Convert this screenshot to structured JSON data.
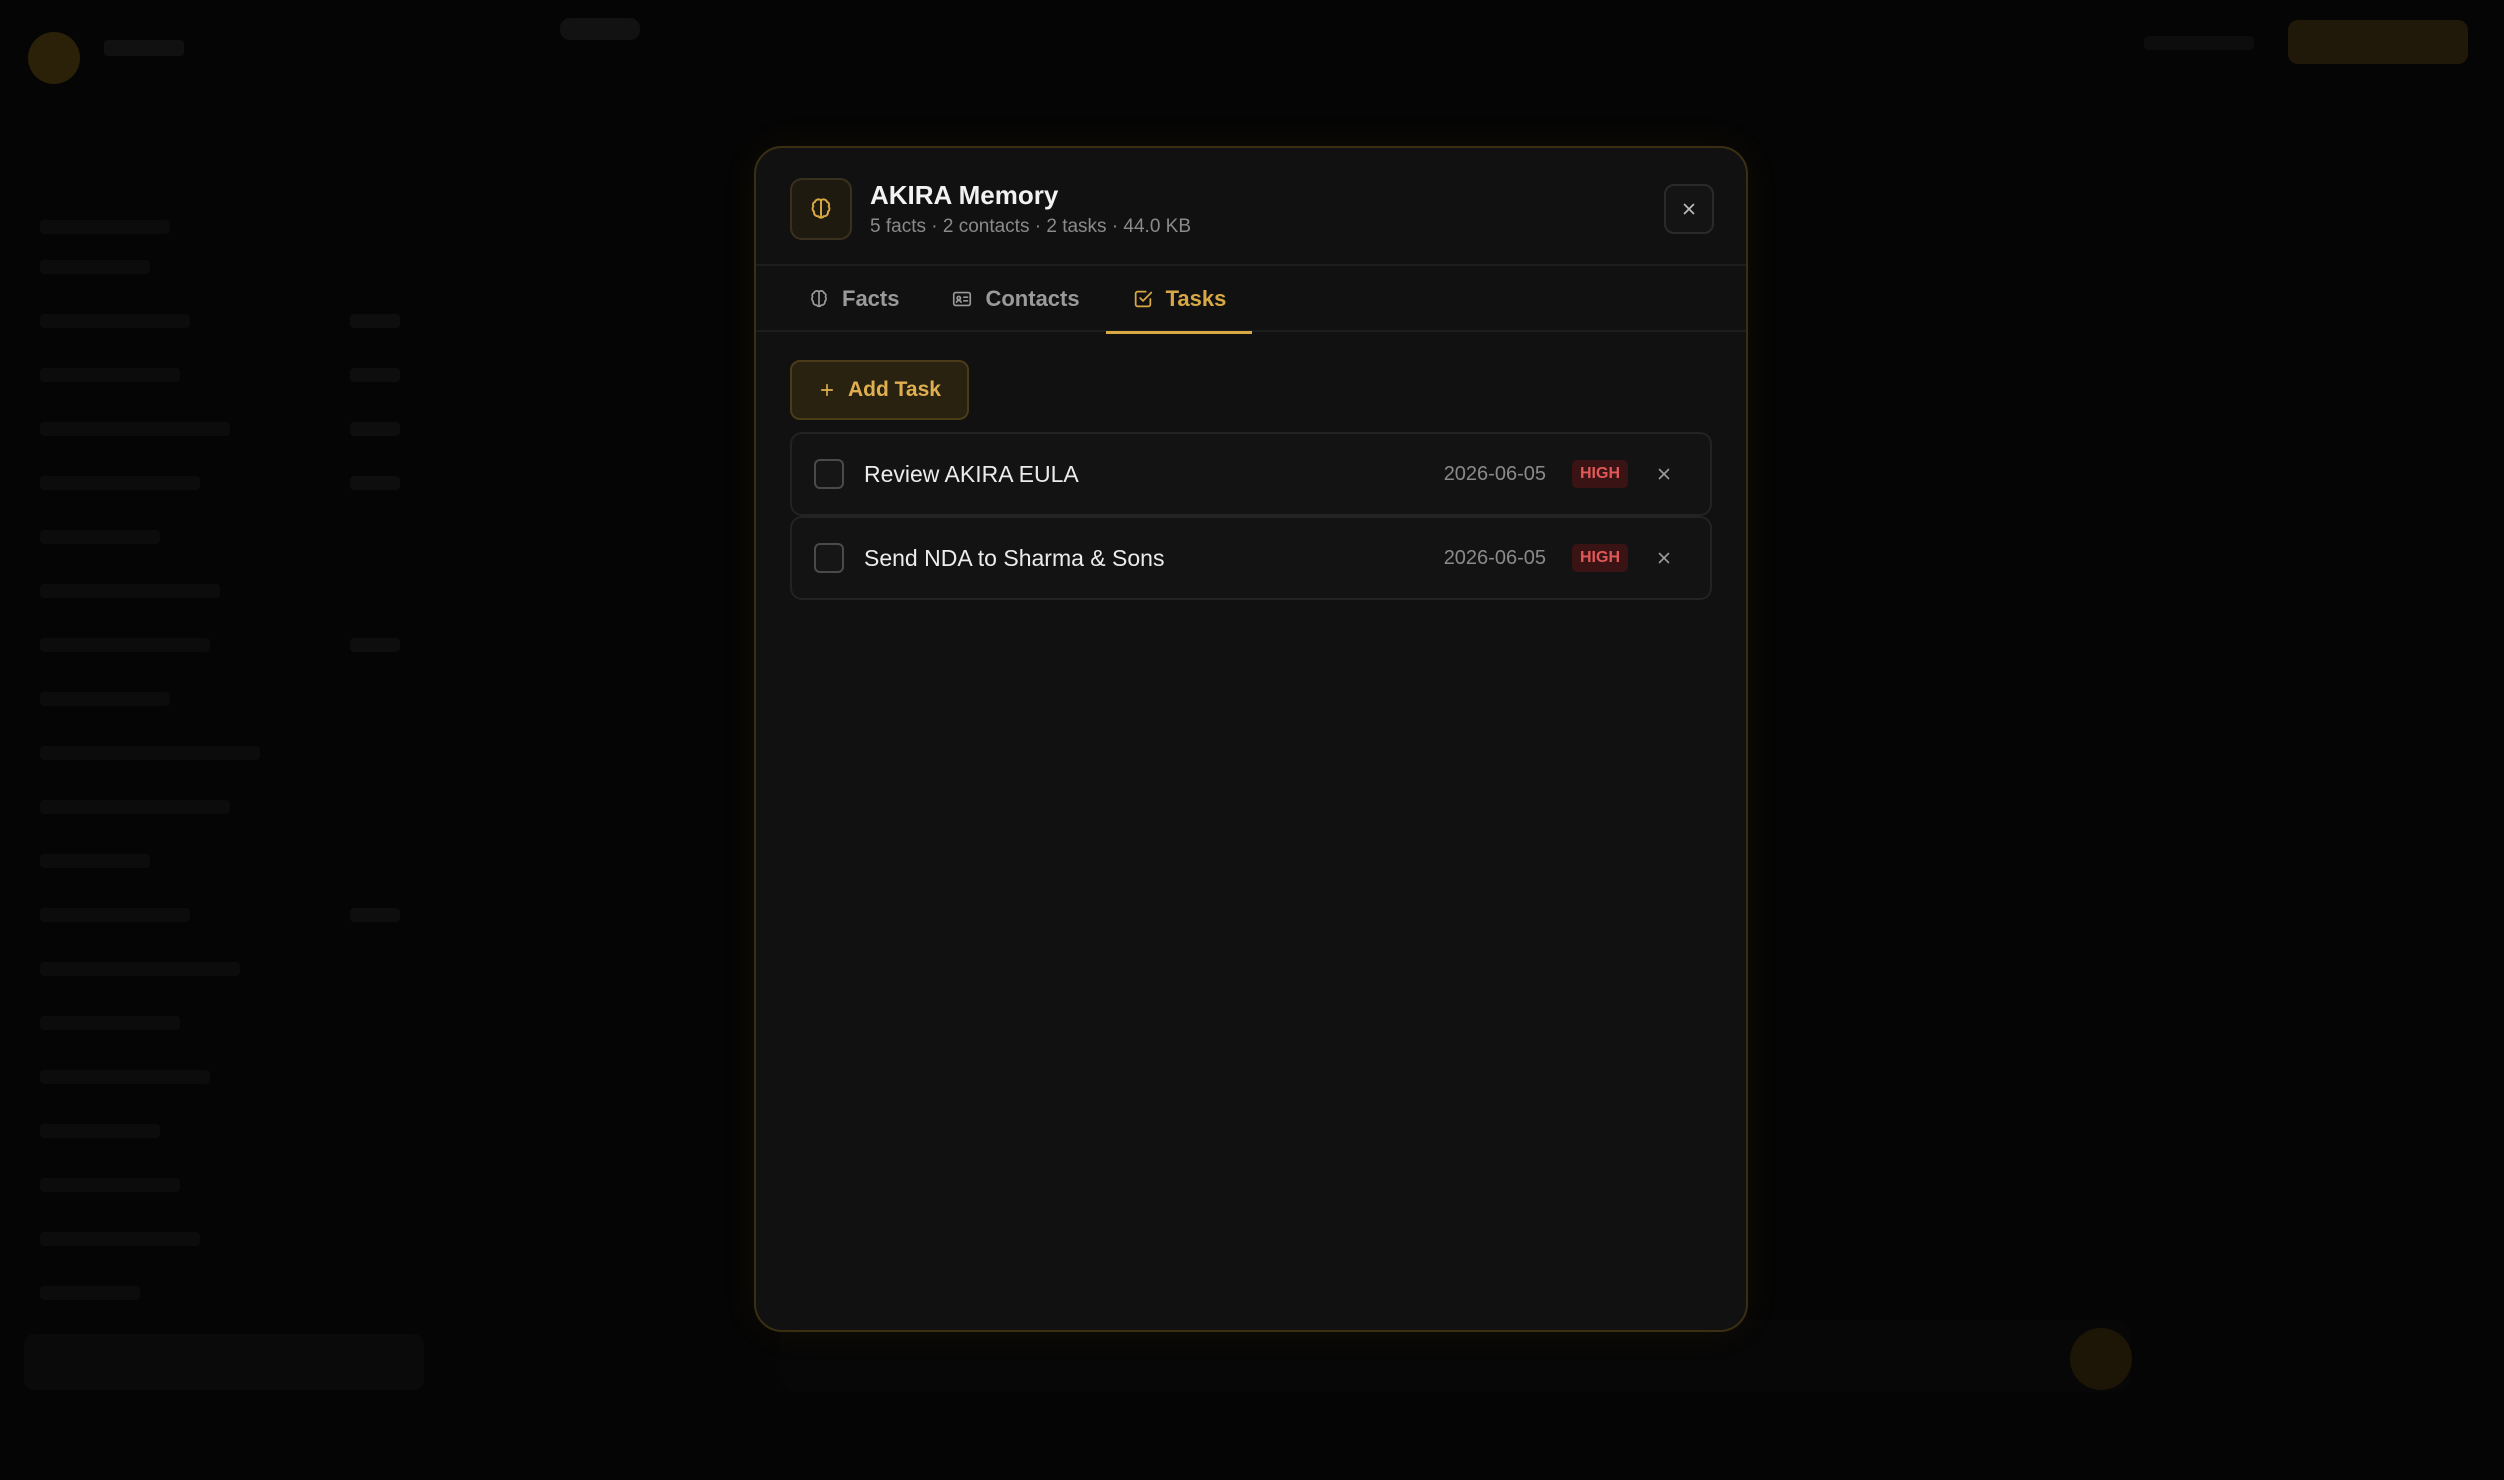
{
  "modal": {
    "title": "AKIRA Memory",
    "subtitle": "5 facts · 2 contacts · 2 tasks · 44.0 KB",
    "icons": {
      "header": "brain-icon",
      "close": "close-icon"
    }
  },
  "tabs": [
    {
      "label": "Facts",
      "icon": "brain-icon",
      "active": false
    },
    {
      "label": "Contacts",
      "icon": "contact-card-icon",
      "active": false
    },
    {
      "label": "Tasks",
      "icon": "checkbox-square-icon",
      "active": true
    }
  ],
  "tasks_panel": {
    "add_label": "Add Task",
    "items": [
      {
        "title": "Review AKIRA EULA",
        "date": "2026-06-05",
        "priority": "HIGH",
        "done": false
      },
      {
        "title": "Send NDA to Sharma & Sons",
        "date": "2026-06-05",
        "priority": "HIGH",
        "done": false
      }
    ]
  },
  "colors": {
    "accent": "#d8a845",
    "priority_high": "#e05858",
    "background": "#000000",
    "modal": "#111111"
  }
}
